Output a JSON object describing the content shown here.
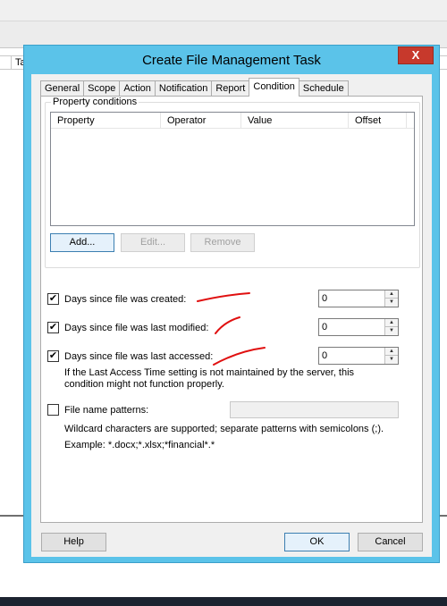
{
  "window": {
    "title": "Create File Management Task",
    "close_glyph": "X"
  },
  "background": {
    "tab_fragment": "Ta"
  },
  "tabs": [
    {
      "label": "General"
    },
    {
      "label": "Scope"
    },
    {
      "label": "Action"
    },
    {
      "label": "Notification"
    },
    {
      "label": "Report"
    },
    {
      "label": "Condition",
      "active": true
    },
    {
      "label": "Schedule"
    }
  ],
  "property_conditions": {
    "group_title": "Property conditions",
    "columns": [
      "Property",
      "Operator",
      "Value",
      "Offset"
    ],
    "rows": [],
    "add_label": "Add...",
    "edit_label": "Edit...",
    "remove_label": "Remove"
  },
  "conditions": {
    "created": {
      "label": "Days since file was created:",
      "checked": true,
      "value": "0"
    },
    "modified": {
      "label": "Days since file was last modified:",
      "checked": true,
      "value": "0"
    },
    "accessed": {
      "label": "Days since file was last accessed:",
      "checked": true,
      "value": "0"
    },
    "access_note": "If the Last Access Time setting is not maintained by the server, this condition might not function properly."
  },
  "file_patterns": {
    "label": "File name patterns:",
    "checked": false,
    "value": "",
    "hint": "Wildcard characters are supported; separate patterns with semicolons (;).",
    "example": "Example: *.docx;*.xlsx;*financial*.*"
  },
  "footer": {
    "help_label": "Help",
    "ok_label": "OK",
    "cancel_label": "Cancel"
  },
  "glyphs": {
    "check": "✔",
    "up": "▲",
    "down": "▼"
  },
  "colors": {
    "title_bar": "#5bc3e9",
    "close_button": "#c7392c",
    "annotation": "#e01010"
  }
}
